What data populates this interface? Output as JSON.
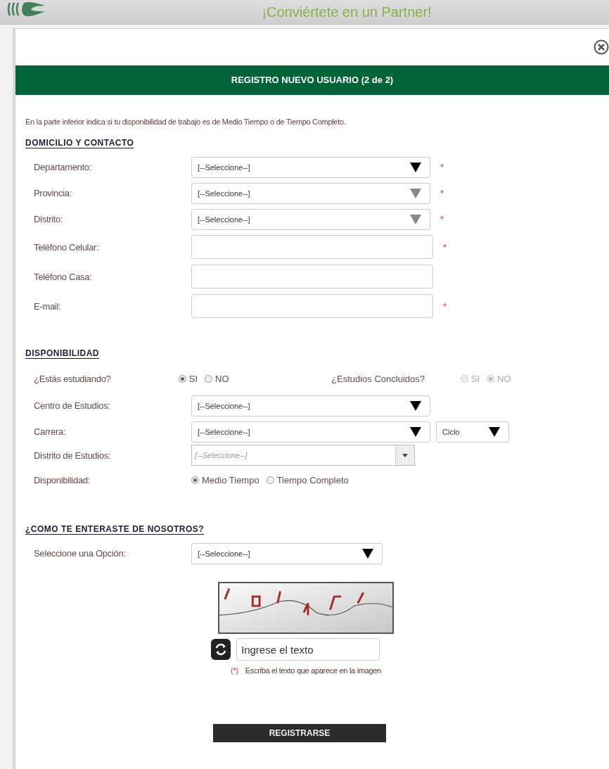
{
  "banner": {
    "title": "¡Conviértete en un Partner!"
  },
  "dialog": {
    "heading": "REGISTRO NUEVO USUARIO (2 de 2)",
    "intro": "En la parte inferior indica si tu disponibilidad de trabajo es de Medio Tiempo o de Tiempo Completo."
  },
  "sections": [
    {
      "title": "DOMICILIO Y CONTACTO",
      "rows": [
        {
          "kind": "select",
          "label": "Departamento:",
          "value": "[--Seleccione--]",
          "disabled": false,
          "mark": "*"
        },
        {
          "kind": "select",
          "label": "Provincia:",
          "value": "[--Seleccione--]",
          "disabled": true,
          "mark": "*"
        },
        {
          "kind": "select",
          "label": "Distrito:",
          "value": "[--Seleccione--]",
          "disabled": true,
          "mark": "*"
        },
        {
          "kind": "text",
          "label": "Teléfono Celular:",
          "mark": "*"
        },
        {
          "kind": "text",
          "label": "Teléfono Casa:"
        },
        {
          "kind": "text",
          "label": "E-mail:",
          "mark": "*"
        }
      ]
    },
    {
      "title": "DISPONIBILIDAD",
      "rows": [
        {
          "kind": "radio",
          "label": "¿Estás estudiando?",
          "disabled": false,
          "options": [
            {
              "label": "SI",
              "selected": true
            },
            {
              "label": "NO",
              "selected": false
            }
          ],
          "extra": {
            "label": "¿Estudios Concluidos?",
            "disabled": true,
            "options": [
              {
                "label": "SI",
                "selected": false
              },
              {
                "label": "NO",
                "selected": true
              }
            ]
          }
        },
        {
          "kind": "select",
          "label": "Centro de Estudios:",
          "value": "[--Seleccione--]",
          "disabled": false
        },
        {
          "kind": "select",
          "label": "Carrera:",
          "value": "[--Seleccione--]",
          "disabled": false,
          "side": {
            "value": "Ciclo"
          }
        },
        {
          "kind": "native",
          "label": "Distrito de Estudios:",
          "value": "[--Seleccione--]"
        },
        {
          "kind": "radio",
          "label": "Disponibilidad:",
          "disabled": false,
          "options": [
            {
              "label": "Medio Tiempo",
              "selected": true
            },
            {
              "label": "Tiempo Completo",
              "selected": false
            }
          ]
        }
      ]
    },
    {
      "title": "¿COMO TE ENTERASTE DE NOSOTROS?",
      "rows": [
        {
          "kind": "select",
          "label": "Seleccione una Opción:",
          "value": "[--Seleccione--]",
          "disabled": false
        }
      ]
    }
  ],
  "captcha": {
    "placeholder": "Ingrese el texto",
    "mark": "(*)",
    "hint": "Escriba el texto que aparece en la imagen"
  },
  "submit": "REGISTRARSE"
}
